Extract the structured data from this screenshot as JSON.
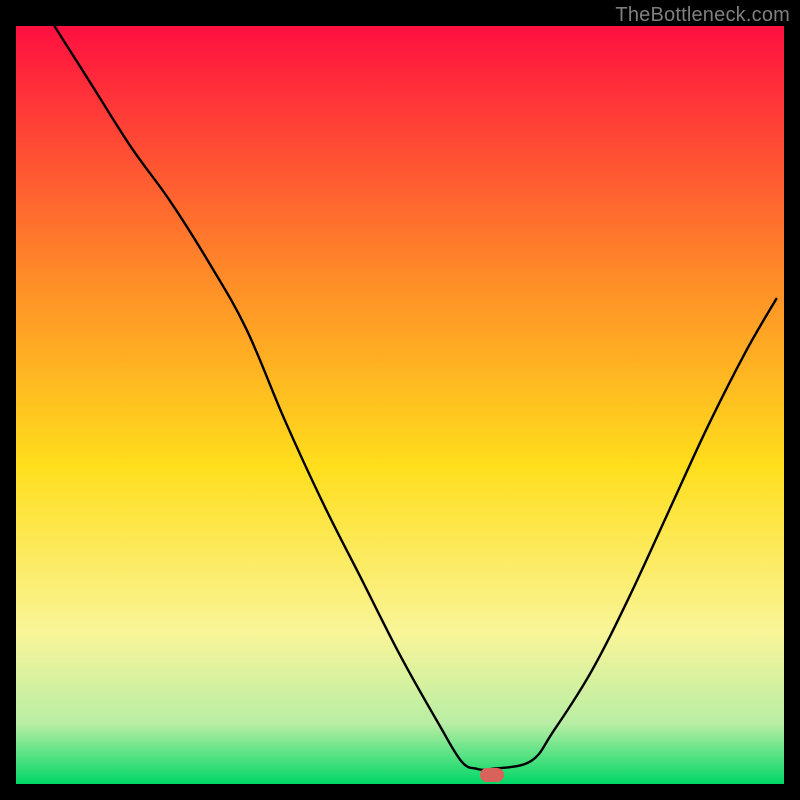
{
  "watermark": "TheBottleneck.com",
  "chart_data": {
    "type": "line",
    "title": "",
    "xlabel": "",
    "ylabel": "",
    "xlim": [
      0,
      100
    ],
    "ylim": [
      0,
      100
    ],
    "gradient_colors": {
      "top": "#ff1040",
      "upper_mid": "#ff8b28",
      "mid": "#ffde1c",
      "lower_mid": "#f9f598",
      "low": "#b9eea4",
      "bottom": "#00d766"
    },
    "series": [
      {
        "name": "bottleneck-curve",
        "x": [
          5,
          10,
          15,
          20,
          25,
          30,
          35,
          40,
          45,
          50,
          55,
          58,
          60,
          62,
          67,
          70,
          75,
          80,
          85,
          90,
          95,
          99
        ],
        "values": [
          100,
          92,
          84,
          77,
          69,
          60,
          48,
          37,
          27,
          17,
          8,
          3,
          2,
          2,
          3,
          7,
          15,
          25,
          36,
          47,
          57,
          64
        ]
      }
    ],
    "marker": {
      "x": 62,
      "y": 1.2,
      "color": "#d9635a"
    }
  }
}
